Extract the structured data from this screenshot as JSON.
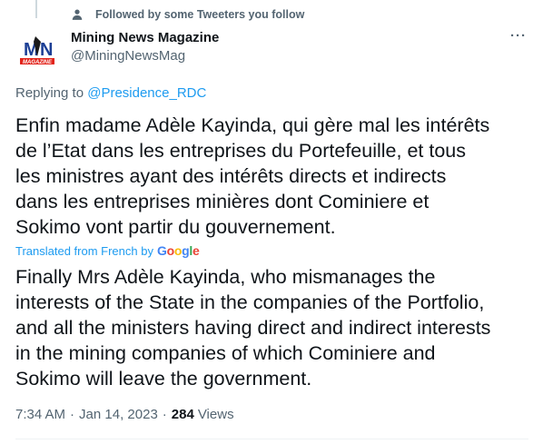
{
  "social_context": {
    "text": "Followed by some Tweeters you follow",
    "icon": "person-icon"
  },
  "author": {
    "name": "Mining News Magazine",
    "handle": "@MiningNewsMag",
    "avatar_letters": "MN",
    "avatar_subtext": "MAGAZINE"
  },
  "more_button": "···",
  "replying": {
    "prefix": "Replying to",
    "mention": "@Presidence_RDC"
  },
  "tweet": {
    "original_text": "Enfin madame Adèle Kayinda, qui gère mal les intérêts\nde l’Etat dans les entreprises du Portefeuille, et tous\nles ministres ayant des intérêts directs et indirects\ndans les entreprises minières dont Cominiere et\nSokimo vont partir du gouvernement.",
    "translated_label": "Translated from French by",
    "translation_provider": "Google",
    "translated_text": "Finally Mrs Adèle Kayinda, who mismanages the\ninterests of the State in the companies of the Portfolio,\nand all the ministers having direct and indirect interests\nin the mining companies of which Cominiere and\nSokimo will leave the government."
  },
  "meta": {
    "time": "7:34 AM",
    "separator": "·",
    "date": "Jan 14, 2023",
    "views_count": "284",
    "views_label": "Views"
  },
  "colors": {
    "link": "#1d9bf0",
    "secondary": "#536471",
    "primary": "#0f1419"
  }
}
